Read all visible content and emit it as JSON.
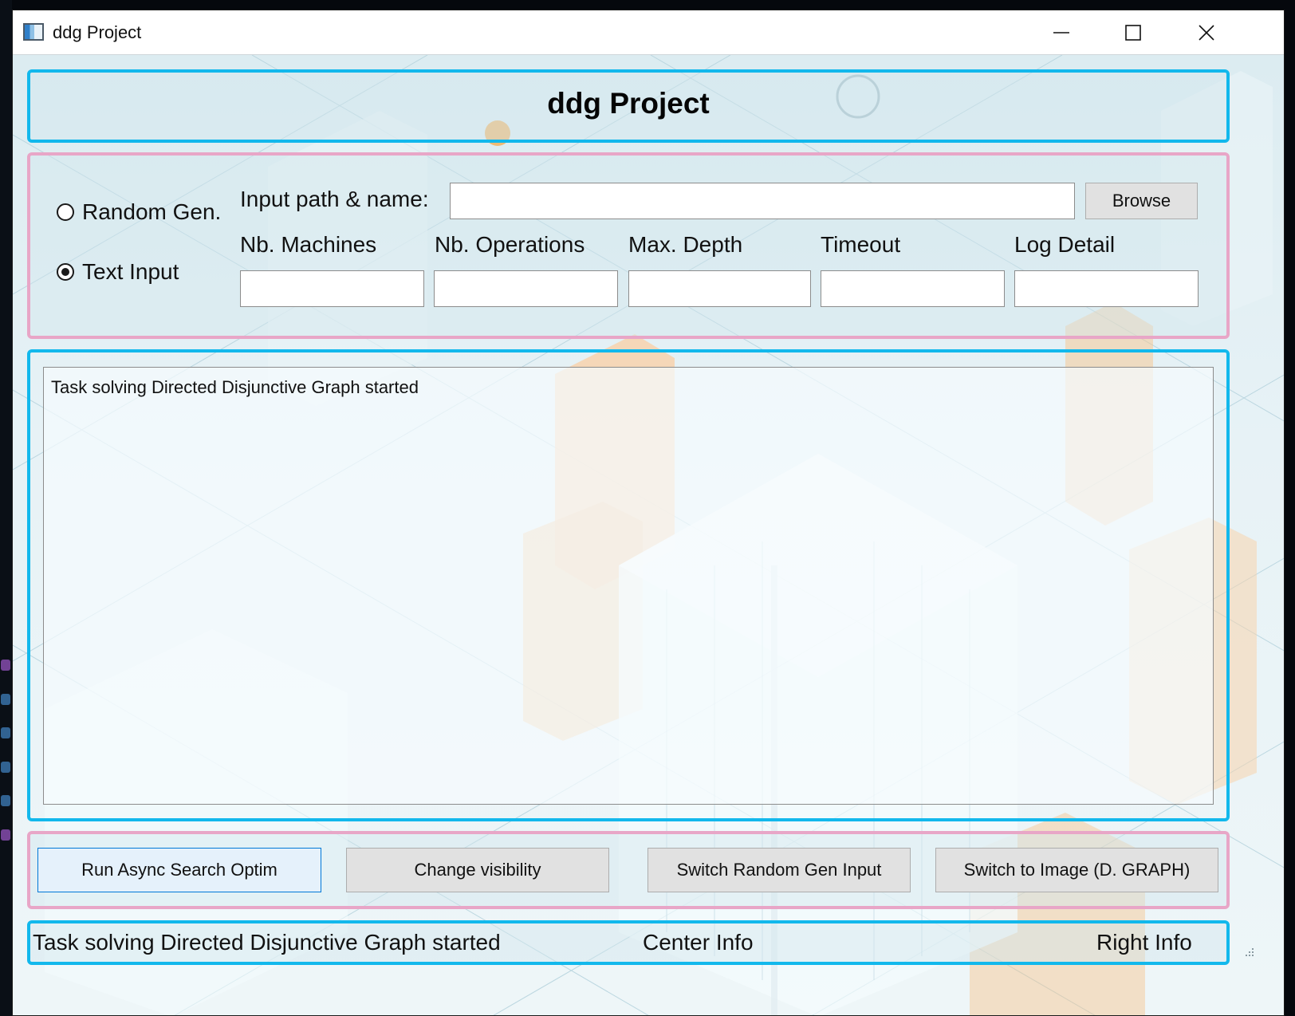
{
  "window": {
    "title": "ddg Project",
    "controls": {
      "minimize": "minimize",
      "maximize": "maximize",
      "close": "close"
    }
  },
  "header": {
    "title": "ddg Project"
  },
  "input_mode": {
    "options": [
      {
        "label": "Random Gen.",
        "checked": false
      },
      {
        "label": "Text Input",
        "checked": true
      }
    ]
  },
  "path": {
    "label": "Input path & name:",
    "value": "",
    "browse_label": "Browse"
  },
  "params": [
    {
      "label": "Nb. Machines",
      "value": ""
    },
    {
      "label": "Nb. Operations",
      "value": ""
    },
    {
      "label": "Max. Depth",
      "value": ""
    },
    {
      "label": "Timeout",
      "value": ""
    },
    {
      "label": "Log Detail",
      "value": ""
    }
  ],
  "log": {
    "text": "Task solving Directed Disjunctive Graph started"
  },
  "actions": [
    {
      "label": "Run Async Search Optim",
      "focused": true
    },
    {
      "label": "Change visibility",
      "focused": false
    },
    {
      "label": "Switch Random Gen Input",
      "focused": false
    },
    {
      "label": "Switch to Image (D. GRAPH)",
      "focused": false
    }
  ],
  "status": {
    "left": "Task solving Directed Disjunctive Graph started",
    "center": "Center Info",
    "right": "Right Info"
  },
  "colors": {
    "frame_blue": "#12b8ec",
    "frame_pink": "#e8a6c7",
    "accent_orange": "#f6c48f"
  }
}
